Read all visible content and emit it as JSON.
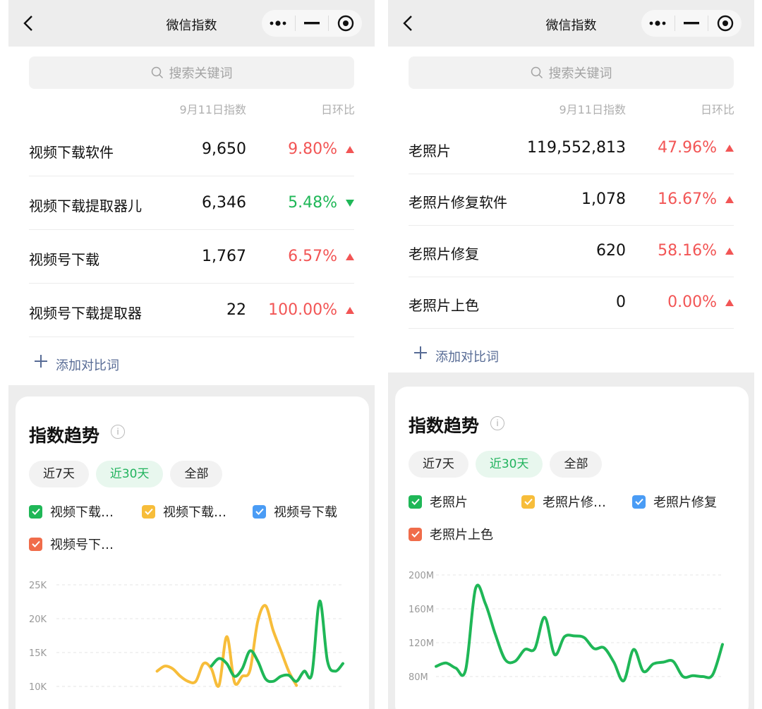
{
  "left": {
    "title": "微信指数",
    "search_placeholder": "搜索关键词",
    "header": {
      "date": "9月11日指数",
      "ratio": "日环比"
    },
    "rows": [
      {
        "term": "视频下载软件",
        "value": "9,650",
        "pct": "9.80%",
        "dir": "up"
      },
      {
        "term": "视频下载提取器儿",
        "value": "6,346",
        "pct": "5.48%",
        "dir": "down"
      },
      {
        "term": "视频号下载",
        "value": "1,767",
        "pct": "6.57%",
        "dir": "up"
      },
      {
        "term": "视频号下载提取器",
        "value": "22",
        "pct": "100.00%",
        "dir": "up"
      }
    ],
    "add_compare": "添加对比词",
    "trend_title": "指数趋势",
    "tabs": [
      {
        "label": "近7天",
        "active": false
      },
      {
        "label": "近30天",
        "active": true
      },
      {
        "label": "全部",
        "active": false
      }
    ],
    "legend": [
      {
        "label": "视频下载…",
        "color": "#1fb757"
      },
      {
        "label": "视频下载…",
        "color": "#f7bd3a"
      },
      {
        "label": "视频号下载",
        "color": "#4a9cf5"
      },
      {
        "label": "视频号下…",
        "color": "#f06c4a"
      }
    ],
    "chart_data": {
      "type": "line",
      "y_ticks": [
        "25K",
        "20K",
        "15K",
        "10K"
      ],
      "ylim": [
        5000,
        25000
      ],
      "grid": true,
      "series": [
        {
          "color": "#f7bd3a",
          "values": [
            null,
            null,
            null,
            null,
            null,
            null,
            null,
            null,
            null,
            null,
            null,
            null,
            null,
            8000,
            9000,
            8500,
            7000,
            6000,
            6000,
            9500,
            8500,
            5200,
            14800,
            5800,
            7000,
            8200,
            17800,
            20900,
            16000,
            12000,
            8000,
            5200
          ]
        },
        {
          "color": "#1fb757",
          "values": [
            null,
            null,
            null,
            null,
            null,
            null,
            null,
            null,
            null,
            null,
            null,
            null,
            null,
            null,
            null,
            null,
            null,
            null,
            null,
            null,
            9000,
            10500,
            9500,
            7000,
            8500,
            12000,
            10000,
            6500,
            6000,
            7000,
            7200,
            6000,
            8000,
            7500,
            21800,
            10000,
            8000,
            9500
          ]
        }
      ]
    }
  },
  "right": {
    "title": "微信指数",
    "search_placeholder": "搜索关键词",
    "header": {
      "date": "9月11日指数",
      "ratio": "日环比"
    },
    "rows": [
      {
        "term": "老照片",
        "value": "119,552,813",
        "pct": "47.96%",
        "dir": "up"
      },
      {
        "term": "老照片修复软件",
        "value": "1,078",
        "pct": "16.67%",
        "dir": "up"
      },
      {
        "term": "老照片修复",
        "value": "620",
        "pct": "58.16%",
        "dir": "up"
      },
      {
        "term": "老照片上色",
        "value": "0",
        "pct": "0.00%",
        "dir": "up"
      }
    ],
    "add_compare": "添加对比词",
    "trend_title": "指数趋势",
    "tabs": [
      {
        "label": "近7天",
        "active": false
      },
      {
        "label": "近30天",
        "active": true
      },
      {
        "label": "全部",
        "active": false
      }
    ],
    "legend": [
      {
        "label": "老照片",
        "color": "#1fb757"
      },
      {
        "label": "老照片修…",
        "color": "#f7bd3a"
      },
      {
        "label": "老照片修复",
        "color": "#4a9cf5"
      },
      {
        "label": "老照片上色",
        "color": "#f06c4a"
      }
    ],
    "chart_data": {
      "type": "line",
      "y_ticks": [
        "200M",
        "160M",
        "120M",
        "80M"
      ],
      "ylim": [
        80000000,
        200000000
      ],
      "grid": true,
      "series": [
        {
          "color": "#1fb757",
          "values": [
            92000000,
            96000000,
            90000000,
            88000000,
            184000000,
            166000000,
            130000000,
            100000000,
            98000000,
            112000000,
            113000000,
            150000000,
            106000000,
            127000000,
            128000000,
            126000000,
            113000000,
            114000000,
            97000000,
            75000000,
            112000000,
            86000000,
            95000000,
            97000000,
            98000000,
            80000000,
            81000000,
            80000000,
            82000000,
            118000000
          ]
        }
      ]
    }
  },
  "colors": {
    "up": "#f25555",
    "down": "#1fb757",
    "link": "#576b95",
    "active_tab": "#22b35e"
  }
}
